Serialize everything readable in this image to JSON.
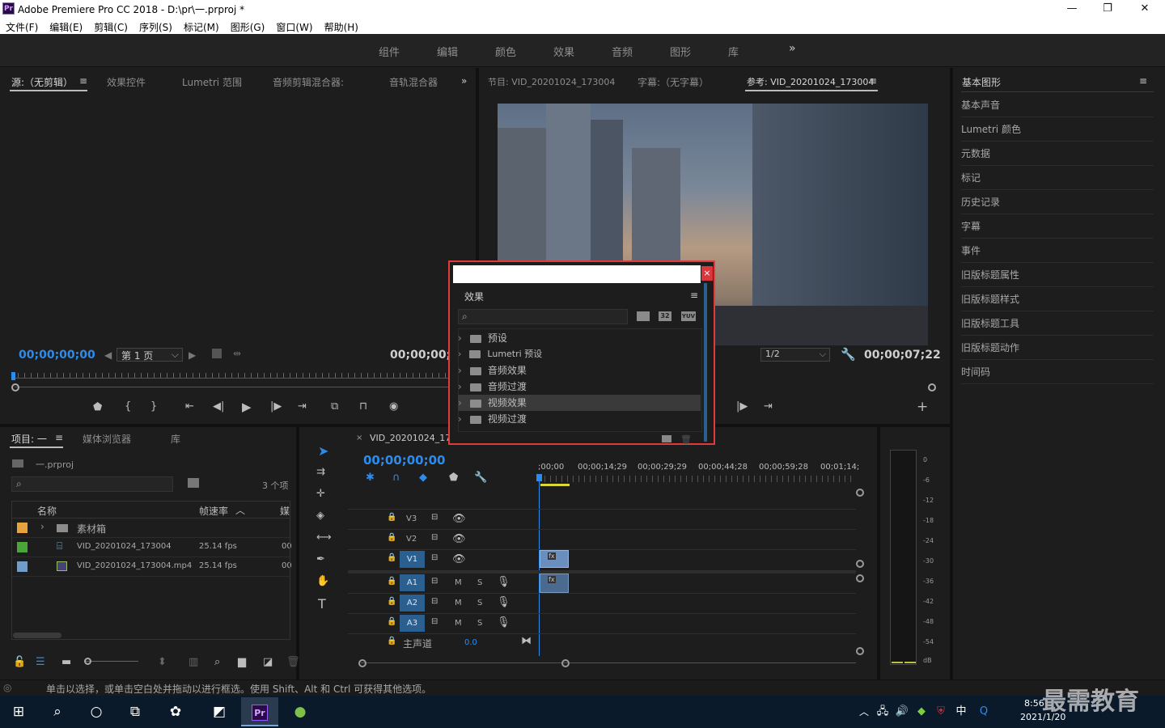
{
  "window": {
    "title": "Adobe Premiere Pro CC 2018 - D:\\pr\\一.prproj *",
    "logo": "Pr",
    "minimize": "—",
    "maximize": "❐",
    "close": "✕"
  },
  "menu": [
    "文件(F)",
    "编辑(E)",
    "剪辑(C)",
    "序列(S)",
    "标记(M)",
    "图形(G)",
    "窗口(W)",
    "帮助(H)"
  ],
  "workspaces": [
    "组件",
    "编辑",
    "颜色",
    "效果",
    "音频",
    "图形",
    "库",
    "»"
  ],
  "source_panel": {
    "tabs": [
      "源:（无剪辑）",
      "效果控件",
      "Lumetri 范围",
      "音频剪辑混合器:",
      "音轨混合器",
      "»"
    ],
    "timecode_left": "00;00;00;00",
    "page_label": "第 1 页",
    "timecode_right": "00;00;00;00"
  },
  "program_panel": {
    "tabs": [
      "节目: VID_20201024_173004",
      "字幕:（无字幕）",
      "参考: VID_20201024_173004"
    ],
    "zoom": "1/2",
    "timecode": "00;00;07;22"
  },
  "right_panel": {
    "title": "基本图形",
    "items": [
      "基本声音",
      "Lumetri 颜色",
      "元数据",
      "标记",
      "历史记录",
      "字幕",
      "事件",
      "旧版标题属性",
      "旧版标题样式",
      "旧版标题工具",
      "旧版标题动作",
      "时间码"
    ]
  },
  "project_panel": {
    "tabs": [
      "项目: 一",
      "媒体浏览器",
      "库"
    ],
    "project_file": "一.prproj",
    "item_count": "3 个项",
    "columns": {
      "name": "名称",
      "fps": "帧速率",
      "media": "媒"
    },
    "rows": [
      {
        "name": "素材箱",
        "fps": "",
        "extra": "",
        "color": "#e8a23b"
      },
      {
        "name": "VID_20201024_173004",
        "fps": "25.14 fps",
        "extra": "00",
        "color": "#4ba63a"
      },
      {
        "name": "VID_20201024_173004.mp4",
        "fps": "25.14 fps",
        "extra": "00",
        "color": "#6e9ccd"
      }
    ]
  },
  "timeline": {
    "tab": "VID_20201024_17300",
    "timecode": "00;00;00;00",
    "ruler": [
      ";00;00",
      "00;00;14;29",
      "00;00;29;29",
      "00;00;44;28",
      "00;00;59;28",
      "00;01;14;"
    ],
    "video_tracks": [
      "V3",
      "V2",
      "V1"
    ],
    "audio_tracks": [
      "A1",
      "A2",
      "A3"
    ],
    "mute": "M",
    "solo": "S",
    "master": "主声道",
    "master_value": "0.0"
  },
  "meter": {
    "labels": [
      "0",
      "-6",
      "-12",
      "-18",
      "-24",
      "-30",
      "-36",
      "-42",
      "-48",
      "-54",
      "dB"
    ]
  },
  "effects_dialog": {
    "title": "效果",
    "close": "×",
    "badges": [
      "32",
      "YUV"
    ],
    "items": [
      "预设",
      "Lumetri 预设",
      "音频效果",
      "音频过渡",
      "视频效果",
      "视频过渡"
    ]
  },
  "status_bar": {
    "text": "单击以选择，或单击空白处并拖动以进行框选。使用 Shift、Alt 和 Ctrl 可获得其他选项。"
  },
  "taskbar": {
    "time": "8:56",
    "date": "2021/1/20",
    "ime": "中",
    "watermark": "最需教育"
  }
}
